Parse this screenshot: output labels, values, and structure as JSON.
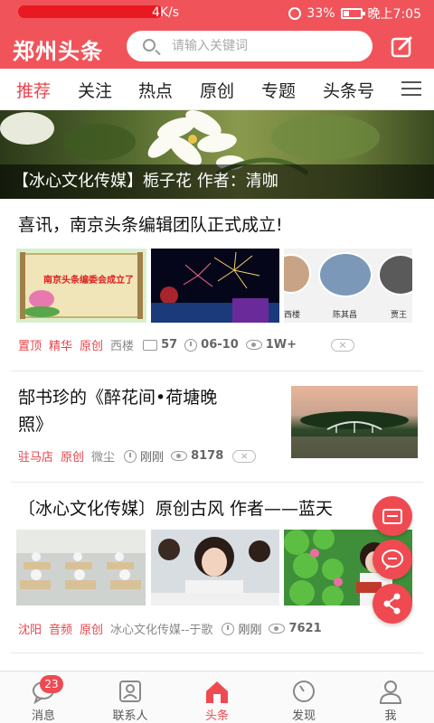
{
  "status_bar": {
    "speed": "4K/s",
    "battery": "33%",
    "time": "晚上7:05"
  },
  "header": {
    "logo": "郑州头条",
    "search_placeholder": "请输入关键词"
  },
  "tabs": [
    "推荐",
    "关注",
    "热点",
    "原创",
    "专题",
    "头条号"
  ],
  "banner": {
    "caption": "【冰心文化传媒】栀子花 作者：清咖"
  },
  "articles": [
    {
      "title": "喜讯，南京头条编辑团队正式成立!",
      "image1_text": "南京头条编委会成立了",
      "image3_names": [
        "西楼",
        "陈其昌",
        "贾王"
      ],
      "tags": [
        "置顶",
        "精华",
        "原创"
      ],
      "source": "西楼",
      "comments": "57",
      "time": "06-10",
      "views": "1W+"
    },
    {
      "title_line1": "郜书珍的《醉花间•荷塘晚",
      "title_line2": "照》",
      "tags": [
        "驻马店",
        "原创"
      ],
      "source": "微尘",
      "time": "刚刚",
      "views": "8178"
    },
    {
      "title": "〔冰心文化传媒〕原创古风 作者——蓝天",
      "tags": [
        "沈阳",
        "音频",
        "原创"
      ],
      "source": "冰心文化传媒--于歌",
      "time": "刚刚",
      "views": "7621"
    }
  ],
  "dismiss_symbol": "×",
  "bottom_nav": [
    {
      "label": "消息",
      "badge": "23"
    },
    {
      "label": "联系人"
    },
    {
      "label": "头条"
    },
    {
      "label": "发现"
    },
    {
      "label": "我"
    }
  ],
  "colors": {
    "brand": "#f0545a",
    "accent": "#e8454c"
  }
}
